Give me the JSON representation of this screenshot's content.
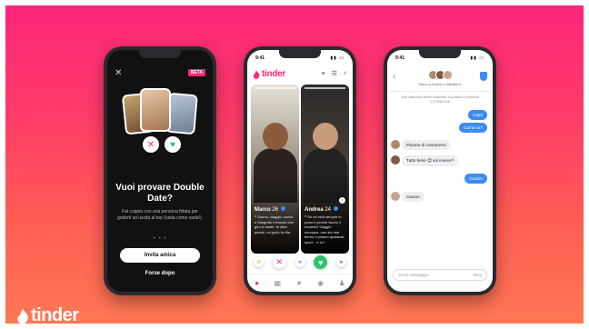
{
  "brand": {
    "wordmark": "tinder",
    "color": "#fd267a"
  },
  "phone1": {
    "beta_badge": "BETA",
    "title": "Vuoi provare Double Date?",
    "body": "Fai coppia con una persona fidata per goderti un'uscita al top (vada come vada!).",
    "page_dots": "• • •",
    "primary_button": "Invita amica",
    "secondary_link": "Forse dopo"
  },
  "phone2": {
    "time": "9:41",
    "app_name": "tinder",
    "cards": [
      {
        "name": "Marco",
        "age": "26",
        "bio": "❝ Suono, viaggio, scrivo e fotografo il mondo che giro in skate. In altre parole, mi godo la vita"
      },
      {
        "name": "Andrea",
        "age": "24",
        "bio": "❝ Se mi vedi sempre in posa è perché faccio il modello! Viaggio ovunque, non sto mai fermo e pratico qualsiasi sport... e tu?"
      }
    ]
  },
  "phone3": {
    "time": "9:41",
    "participants": "Marco ● Andrea ● Valentina ●",
    "system_note": "Sua Valentina avete matchato con Marco e Andrea il 27/05/2025",
    "messages": [
      {
        "dir": "out",
        "text": "Ciao!"
      },
      {
        "dir": "out",
        "text": "Come va?"
      },
      {
        "dir": "in",
        "text": "Piacere di conoscervi"
      },
      {
        "dir": "in",
        "text": "Tutto bene 😊 voi invece?"
      },
      {
        "dir": "out",
        "text": "Grazie!"
      },
      {
        "dir": "in",
        "text": "Ciaooo"
      }
    ],
    "input_placeholder": "Scrivi messaggio",
    "send_label": "Invia"
  }
}
